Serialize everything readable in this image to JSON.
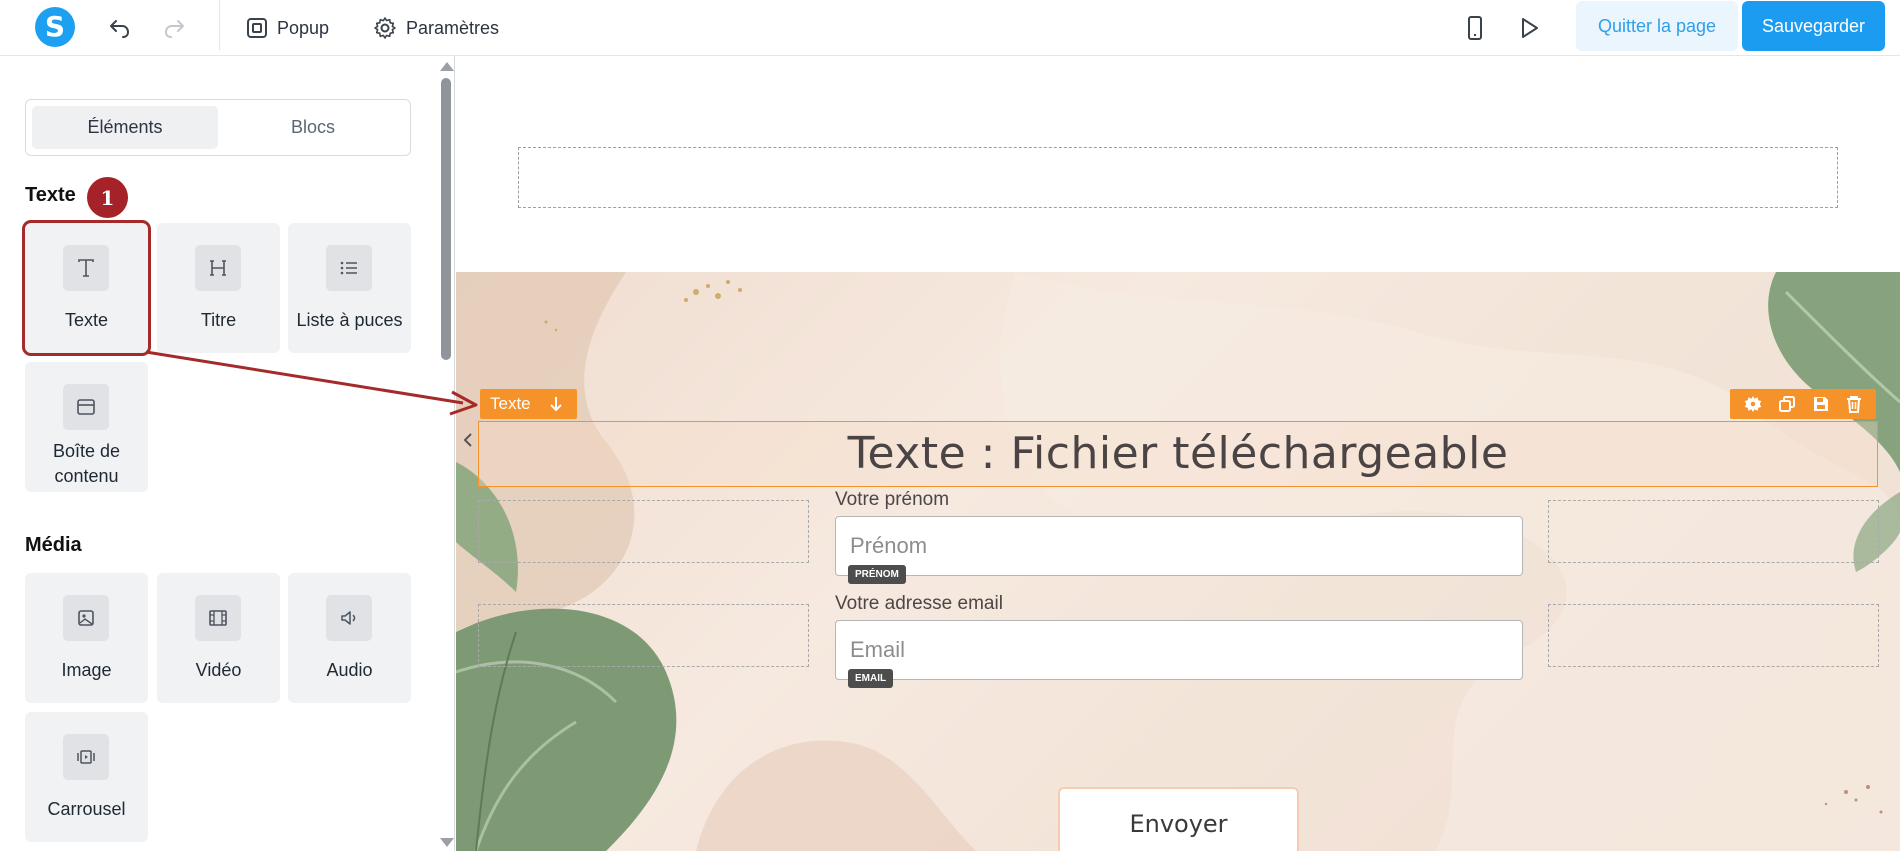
{
  "topbar": {
    "logo_letter": "S",
    "popup_label": "Popup",
    "settings_label": "Paramètres",
    "quit_label": "Quitter la page",
    "save_label": "Sauvegarder"
  },
  "sidebar": {
    "tabs": [
      {
        "label": "Éléments",
        "active": true
      },
      {
        "label": "Blocs",
        "active": false
      }
    ],
    "sections": [
      {
        "title": "Texte",
        "badge": "1",
        "items": [
          {
            "label": "Texte",
            "icon": "text-icon"
          },
          {
            "label": "Titre",
            "icon": "heading-icon"
          },
          {
            "label": "Liste à puces",
            "icon": "list-icon"
          },
          {
            "label": "Boîte de contenu",
            "icon": "content-box-icon"
          }
        ]
      },
      {
        "title": "Média",
        "items": [
          {
            "label": "Image",
            "icon": "image-icon"
          },
          {
            "label": "Vidéo",
            "icon": "video-icon"
          },
          {
            "label": "Audio",
            "icon": "audio-icon"
          },
          {
            "label": "Carrousel",
            "icon": "carousel-icon"
          }
        ]
      }
    ]
  },
  "canvas": {
    "selected_tag": "Texte",
    "title": "Texte : Fichier téléchargeable",
    "fields": [
      {
        "label": "Votre prénom",
        "placeholder": "Prénom",
        "chip": "PRÉNOM"
      },
      {
        "label": "Votre adresse email",
        "placeholder": "Email",
        "chip": "EMAIL"
      }
    ],
    "submit_label": "Envoyer"
  },
  "colors": {
    "brand": "#1c9cf0",
    "selection": "#f5922a",
    "annotation": "#a52a2a"
  }
}
